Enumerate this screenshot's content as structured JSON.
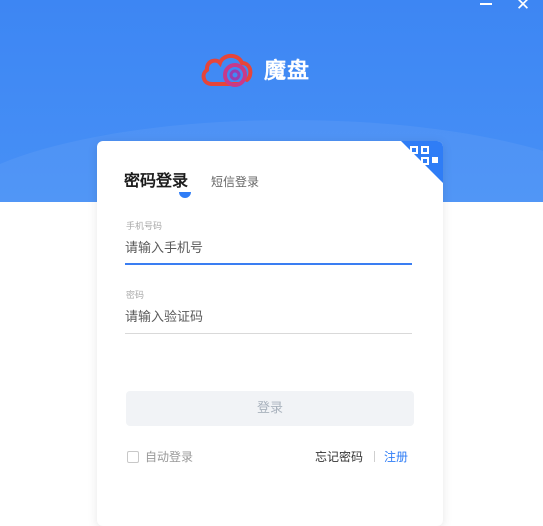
{
  "window": {
    "minimize_glyph": "",
    "close_glyph": "✕"
  },
  "brand": {
    "name": "魔盘",
    "logo_icon": "cloud-disc-icon",
    "colors": {
      "banner": "#3d86f3",
      "logo_red": "#e6453a"
    }
  },
  "tabs": [
    {
      "label": "密码登录",
      "active": true
    },
    {
      "label": "短信登录",
      "active": false
    }
  ],
  "qr_icon": "qr-code-icon",
  "fields": {
    "phone": {
      "label": "手机号码",
      "placeholder": "请输入手机号",
      "value": ""
    },
    "password": {
      "label": "密码",
      "placeholder": "请输入验证码",
      "value": ""
    }
  },
  "login_button": {
    "label": "登录",
    "enabled": false
  },
  "auto_login": {
    "label": "自动登录",
    "checked": false
  },
  "links": {
    "forgot": "忘记密码",
    "register": "注册"
  },
  "colors": {
    "accent": "#2f7df6",
    "button_disabled_bg": "#f1f3f6"
  }
}
